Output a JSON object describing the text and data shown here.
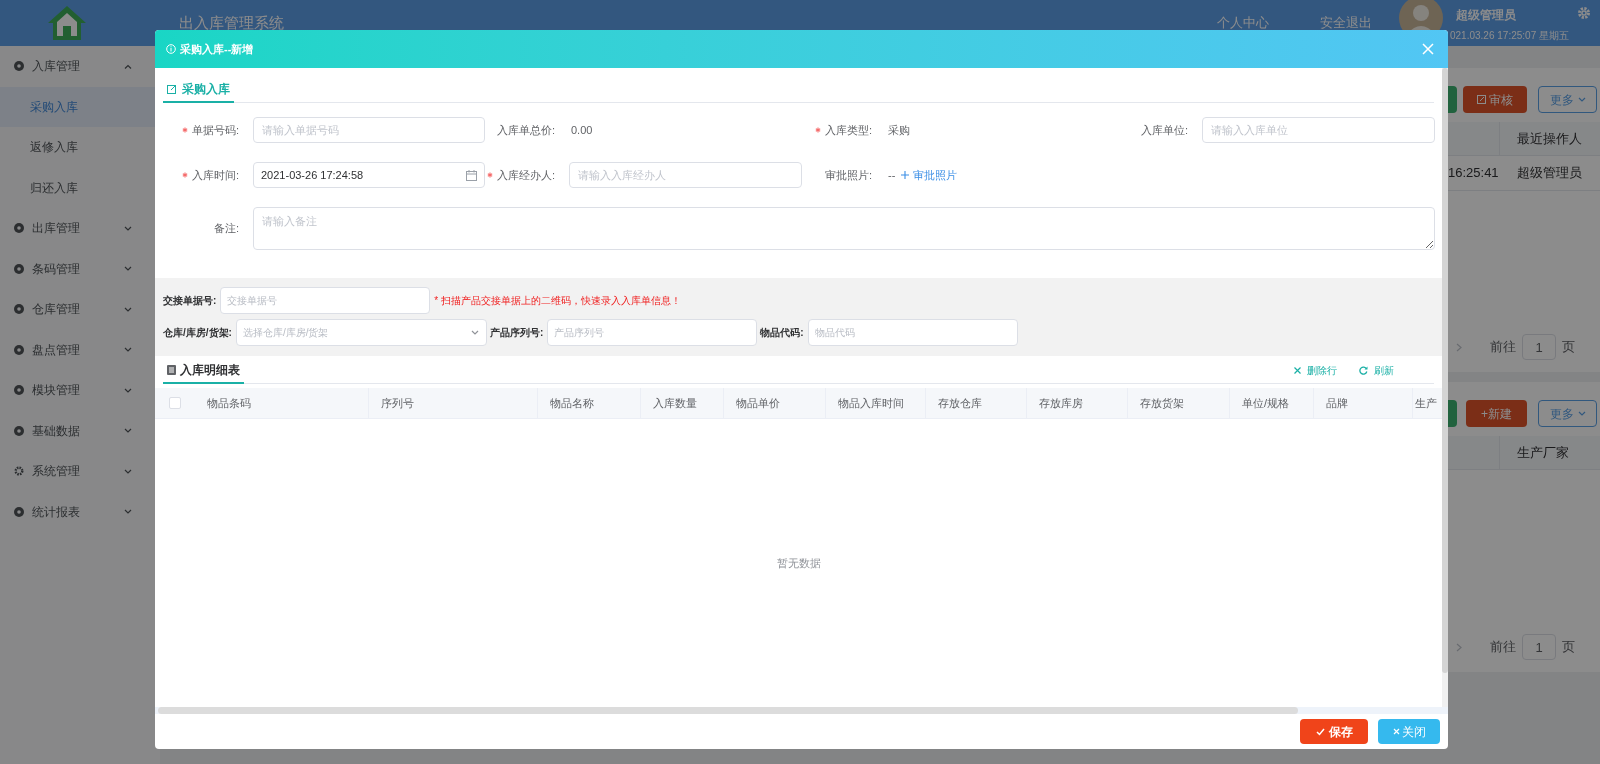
{
  "app": {
    "title": "出入库管理系统",
    "nav_links": [
      "个人中心",
      "安全退出"
    ],
    "user": {
      "name": "超级管理员",
      "datetime": "021.03.26 17:25:07 星期五"
    }
  },
  "sidebar": {
    "items": [
      {
        "label": "入库管理",
        "expanded": true,
        "children": [
          {
            "label": "采购入库",
            "selected": true
          },
          {
            "label": "返修入库",
            "selected": false
          },
          {
            "label": "归还入库",
            "selected": false
          }
        ]
      },
      {
        "label": "出库管理",
        "expanded": false
      },
      {
        "label": "条码管理",
        "expanded": false
      },
      {
        "label": "仓库管理",
        "expanded": false
      },
      {
        "label": "盘点管理",
        "expanded": false
      },
      {
        "label": "模块管理",
        "expanded": false
      },
      {
        "label": "基础数据",
        "expanded": false
      },
      {
        "label": "系统管理",
        "expanded": false
      },
      {
        "label": "统计报表",
        "expanded": false
      }
    ]
  },
  "background_panels": [
    {
      "buttons": [
        {
          "label": "审核",
          "kind": "danger_icon"
        },
        {
          "label": "更多",
          "kind": "outline_menu"
        }
      ],
      "header": [
        "最近操作人"
      ],
      "rows": [
        [
          "16:25:41",
          "超级管理员"
        ]
      ],
      "pagination": {
        "goto": "前往",
        "page": "1",
        "suffix": "页"
      }
    },
    {
      "buttons": [
        {
          "label": "+新建",
          "kind": "danger"
        },
        {
          "label": "更多",
          "kind": "outline_menu"
        }
      ],
      "header": [
        "生产厂家"
      ],
      "pagination": {
        "goto": "前往",
        "page": "1",
        "suffix": "页"
      }
    }
  ],
  "dialog": {
    "title": "采购入库--新增",
    "tab": "采购入库",
    "form": {
      "rows": [
        [
          {
            "kind": "input",
            "label": "单据号码:",
            "required": true,
            "placeholder": "请输入单据号码"
          },
          {
            "kind": "text",
            "label": "入库单总价:",
            "required": false,
            "value": "0.00"
          },
          {
            "kind": "text",
            "label": "入库类型:",
            "required": true,
            "value": "采购"
          },
          {
            "kind": "input",
            "label": "入库单位:",
            "required": false,
            "placeholder": "请输入入库单位"
          }
        ],
        [
          {
            "kind": "date",
            "label": "入库时间:",
            "required": true,
            "value": "2021-03-26 17:24:58"
          },
          {
            "kind": "input",
            "label": "入库经办人:",
            "required": true,
            "placeholder": "请输入入库经办人"
          },
          {
            "kind": "photo",
            "label": "审批照片:",
            "required": false,
            "value": "--",
            "action": "审批照片"
          }
        ],
        [
          {
            "kind": "textarea",
            "label": "备注:",
            "required": false,
            "placeholder": "请输入备注"
          }
        ]
      ]
    },
    "scan": {
      "rows": [
        [
          {
            "kind": "input",
            "label": "交接单据号:",
            "placeholder": "交接单据号"
          },
          {
            "kind": "hint",
            "text": "* 扫描产品交接单据上的二维码，快速录入入库单信息！"
          }
        ],
        [
          {
            "kind": "select",
            "label": "仓库/库房/货架:",
            "placeholder": "选择仓库/库房/货架"
          },
          {
            "kind": "input",
            "label": "产品序列号:",
            "placeholder": "产品序列号"
          },
          {
            "kind": "input",
            "label": "物品代码:",
            "placeholder": "物品代码"
          }
        ]
      ]
    },
    "detail": {
      "tab": "入库明细表",
      "actions": [
        {
          "kind": "delete",
          "label": "删除行"
        },
        {
          "kind": "refresh",
          "label": "刷新"
        }
      ],
      "select_all_checked": false,
      "columns": [
        "物品条码",
        "序列号",
        "物品名称",
        "入库数量",
        "物品单价",
        "物品入库时间",
        "存放仓库",
        "存放库房",
        "存放货架",
        "单位/规格",
        "品牌",
        "生产"
      ],
      "empty_text": "暂无数据"
    },
    "footer_buttons": [
      {
        "kind": "save",
        "label": "保存"
      },
      {
        "kind": "close",
        "label": "关闭"
      }
    ]
  }
}
